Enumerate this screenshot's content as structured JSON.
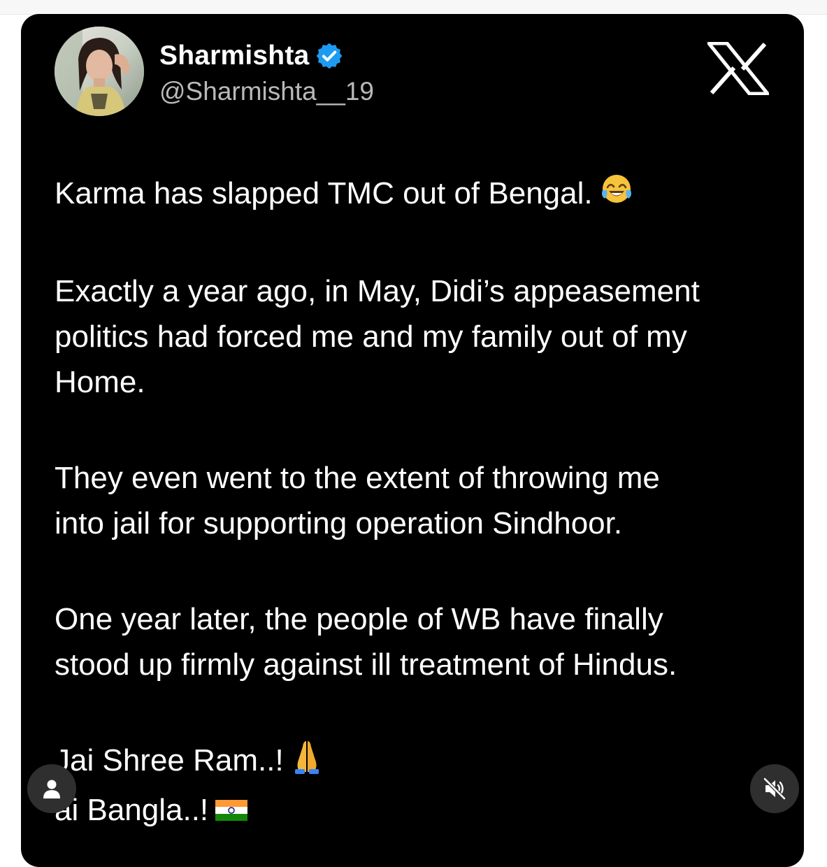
{
  "post": {
    "author": {
      "display_name": "Sharmishta",
      "handle": "@Sharmishta__19",
      "verified": true,
      "verified_icon": "verified-badge-icon",
      "avatar_icon": "profile-photo"
    },
    "platform_icon": "x-logo-icon",
    "paragraphs": [
      {
        "lines": [
          "Karma has slapped TMC out of Bengal."
        ],
        "emoji": "😂",
        "emoji_icon": "face-with-tears-of-joy-icon"
      },
      {
        "lines": [
          "Exactly a year ago, in May, Didi’s appeasement",
          "politics had forced me and my family out of my",
          "Home."
        ]
      },
      {
        "lines": [
          "They even went to the extent of throwing me",
          "into jail for supporting operation Sindhoor."
        ]
      },
      {
        "lines": [
          "One year later, the people of WB have finally",
          "stood up firmly against ill treatment of Hindus."
        ]
      },
      {
        "lines": [
          "Jai Shree Ram..!"
        ],
        "emoji": "🙏",
        "emoji_icon": "folded-hands-icon"
      },
      {
        "lines": [
          "ai Bangla..!"
        ],
        "emoji": "🇮🇳",
        "emoji_icon": "india-flag-icon"
      }
    ]
  },
  "overlay": {
    "user_button_icon": "person-icon",
    "mute_button_icon": "muted-speaker-icon"
  },
  "colors": {
    "card_background": "#000000",
    "text": "#ffffff",
    "handle_text": "#b9b9b9",
    "verified_blue": "#1d9bf0",
    "fab_background": "#2f2f2f"
  }
}
